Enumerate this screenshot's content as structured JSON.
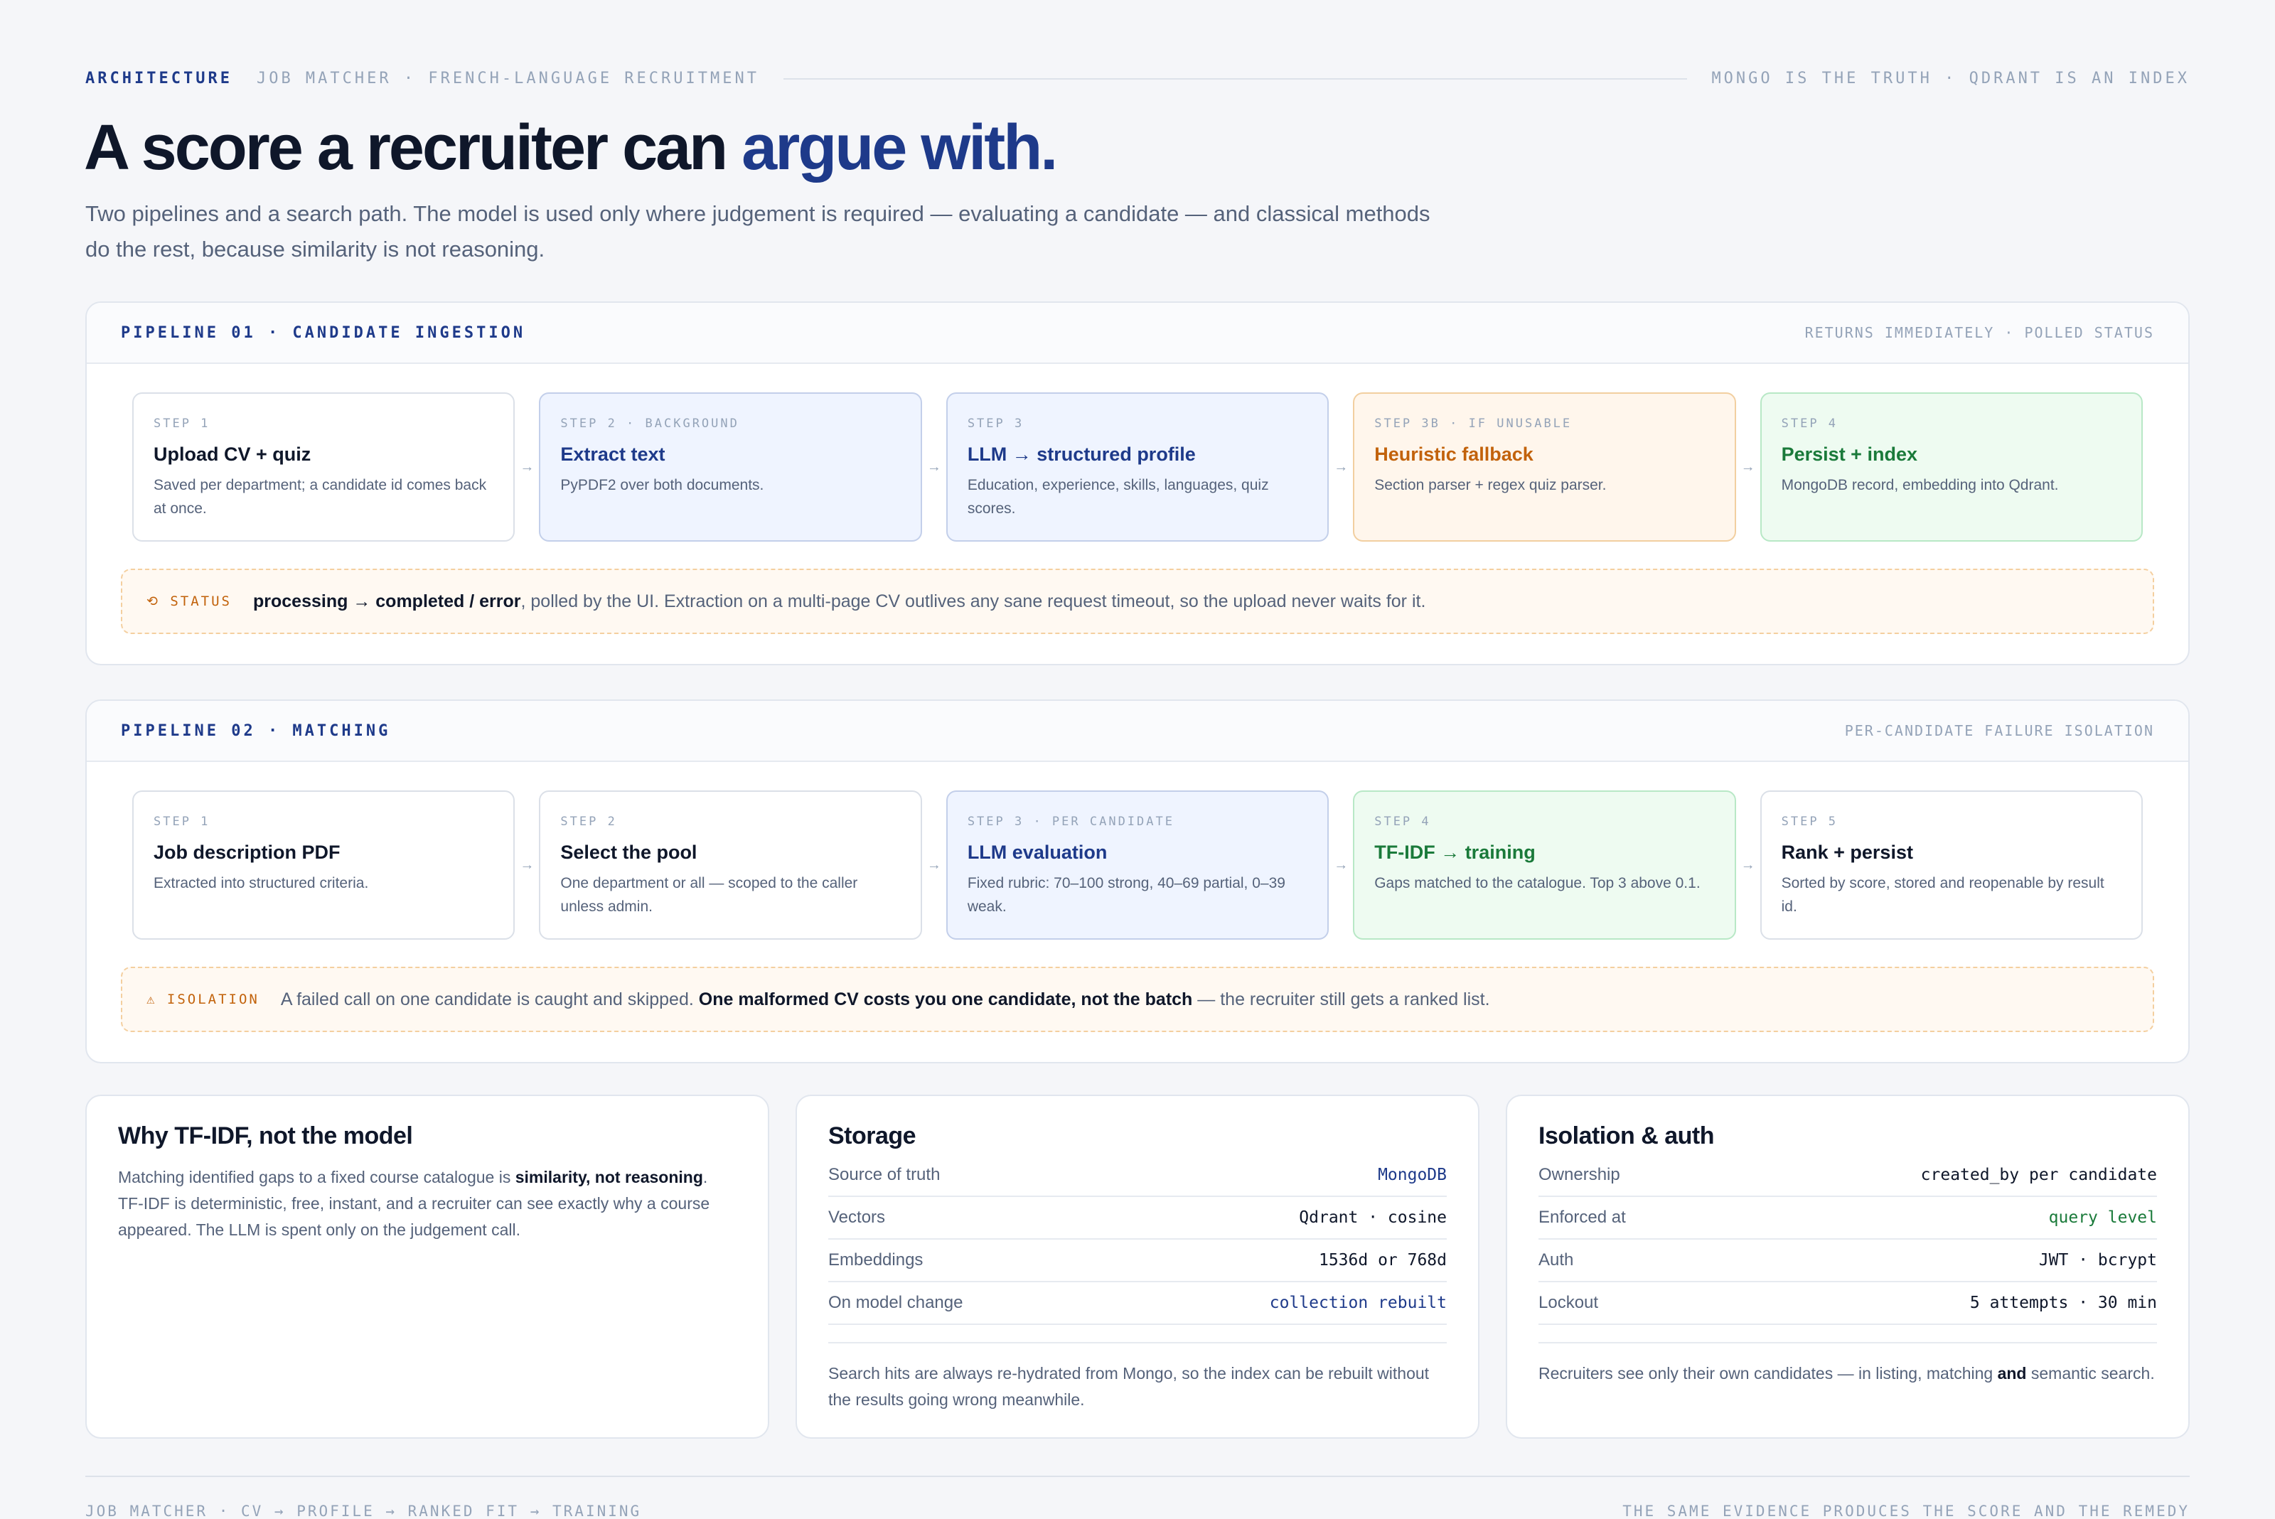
{
  "header": {
    "eyebrow": "ARCHITECTURE",
    "subtitle": "JOB MATCHER · FRENCH-LANGUAGE RECRUITMENT",
    "tagline": "MONGO IS THE TRUTH · QDRANT IS AN INDEX"
  },
  "hero": {
    "title_main": "A score a recruiter can ",
    "title_accent": "argue with.",
    "subtitle": "Two pipelines and a search path. The model is used only where judgement is required — evaluating a candidate — and classical methods do the rest, because similarity is not reasoning."
  },
  "pipeline1": {
    "title": "PIPELINE 01 · CANDIDATE INGESTION",
    "note": "RETURNS IMMEDIATELY · POLLED STATUS",
    "steps": [
      {
        "label": "STEP 1",
        "title": "Upload CV + quiz",
        "desc": "Saved per department; a candidate id comes back at once."
      },
      {
        "label": "STEP 2 · BACKGROUND",
        "title": "Extract text",
        "desc": "PyPDF2 over both documents."
      },
      {
        "label": "STEP 3",
        "title": "LLM → structured profile",
        "desc": "Education, experience, skills, languages, quiz scores."
      },
      {
        "label": "STEP 3b · IF UNUSABLE",
        "title": "Heuristic fallback",
        "desc": "Section parser + regex quiz parser."
      },
      {
        "label": "STEP 4",
        "title": "Persist + index",
        "desc": "MongoDB record, embedding into Qdrant."
      }
    ],
    "callout": {
      "tag": "⟲ STATUS",
      "bold": "processing → completed / error",
      "text": ", polled by the UI. Extraction on a multi-page CV outlives any sane request timeout, so the upload never waits for it."
    }
  },
  "pipeline2": {
    "title": "PIPELINE 02 · MATCHING",
    "note": "PER-CANDIDATE FAILURE ISOLATION",
    "steps": [
      {
        "label": "STEP 1",
        "title": "Job description PDF",
        "desc": "Extracted into structured criteria."
      },
      {
        "label": "STEP 2",
        "title": "Select the pool",
        "desc": "One department or all — scoped to the caller unless admin."
      },
      {
        "label": "STEP 3 · PER CANDIDATE",
        "title": "LLM evaluation",
        "desc": "Fixed rubric: 70–100 strong, 40–69 partial, 0–39 weak."
      },
      {
        "label": "STEP 4",
        "title": "TF-IDF → training",
        "desc": "Gaps matched to the catalogue. Top 3 above 0.1."
      },
      {
        "label": "STEP 5",
        "title": "Rank + persist",
        "desc": "Sorted by score, stored and reopenable by result id."
      }
    ],
    "callout": {
      "tag": "⚠ ISOLATION",
      "text_before": "A failed call on one candidate is caught and skipped. ",
      "bold": "One malformed CV costs you one candidate, not the batch",
      "text_after": " — the recruiter still gets a ranked list."
    }
  },
  "cards": {
    "tfidf": {
      "title": "Why TF-IDF, not the model",
      "text_before": "Matching identified gaps to a fixed course catalogue is ",
      "bold": "similarity, not reasoning",
      "text_after": ". TF-IDF is deterministic, free, instant, and a recruiter can see exactly why a course appeared. The LLM is spent only on the judgement call."
    },
    "storage": {
      "title": "Storage",
      "rows": [
        {
          "k": "Source of truth",
          "v": "MongoDB"
        },
        {
          "k": "Vectors",
          "v": "Qdrant · cosine"
        },
        {
          "k": "Embeddings",
          "v": "1536d or 768d"
        },
        {
          "k": "On model change",
          "v": "collection rebuilt"
        }
      ],
      "foot": "Search hits are always re-hydrated from Mongo, so the index can be rebuilt without the results going wrong meanwhile."
    },
    "auth": {
      "title": "Isolation & auth",
      "rows": [
        {
          "k": "Ownership",
          "v": "created_by per candidate"
        },
        {
          "k": "Enforced at",
          "v": "query level"
        },
        {
          "k": "Auth",
          "v": "JWT · bcrypt"
        },
        {
          "k": "Lockout",
          "v": "5 attempts · 30 min"
        }
      ],
      "foot_before": "Recruiters see only their own candidates — in listing, matching ",
      "foot_bold": "and",
      "foot_after": " semantic search."
    }
  },
  "footer": {
    "left": "JOB MATCHER · CV → PROFILE → RANKED FIT → TRAINING",
    "right": "THE SAME EVIDENCE PRODUCES THE SCORE AND THE REMEDY"
  },
  "colors": {
    "accent": "#1e3a8a",
    "warning": "#c2620b",
    "success": "#1a7a3a",
    "text": "#0f172a",
    "muted": "#55627a"
  }
}
